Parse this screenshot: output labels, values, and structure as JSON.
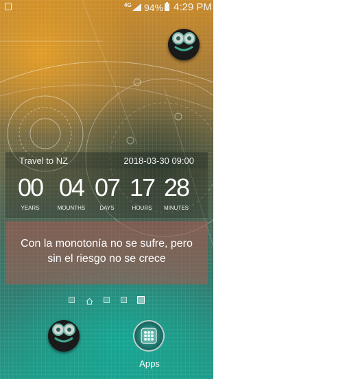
{
  "status_bar": {
    "network": "4G",
    "battery_percent": "94%",
    "time": "4:29 PM"
  },
  "countdown_widget": {
    "event_name": "Travel to NZ",
    "target_date": "2018-03-30 09:00",
    "units": [
      {
        "value": "00",
        "label": "YEARS"
      },
      {
        "value": "04",
        "label": "MOUNTHS"
      },
      {
        "value": "07",
        "label": "DAYS"
      },
      {
        "value": "17",
        "label": "HOURS"
      },
      {
        "value": "28",
        "label": "MINUTES"
      }
    ]
  },
  "quote": "Con la monotonía no se sufre, pero\nsin el riesgo no se crece",
  "page_indicator": {
    "pages": 5,
    "active_index": 4
  },
  "dock": {
    "apps_label": "Apps"
  },
  "colors": {
    "wallpaper_top": "#c98a2a",
    "wallpaper_bottom": "#1f9a88",
    "quote_box": "#aa5a50"
  }
}
